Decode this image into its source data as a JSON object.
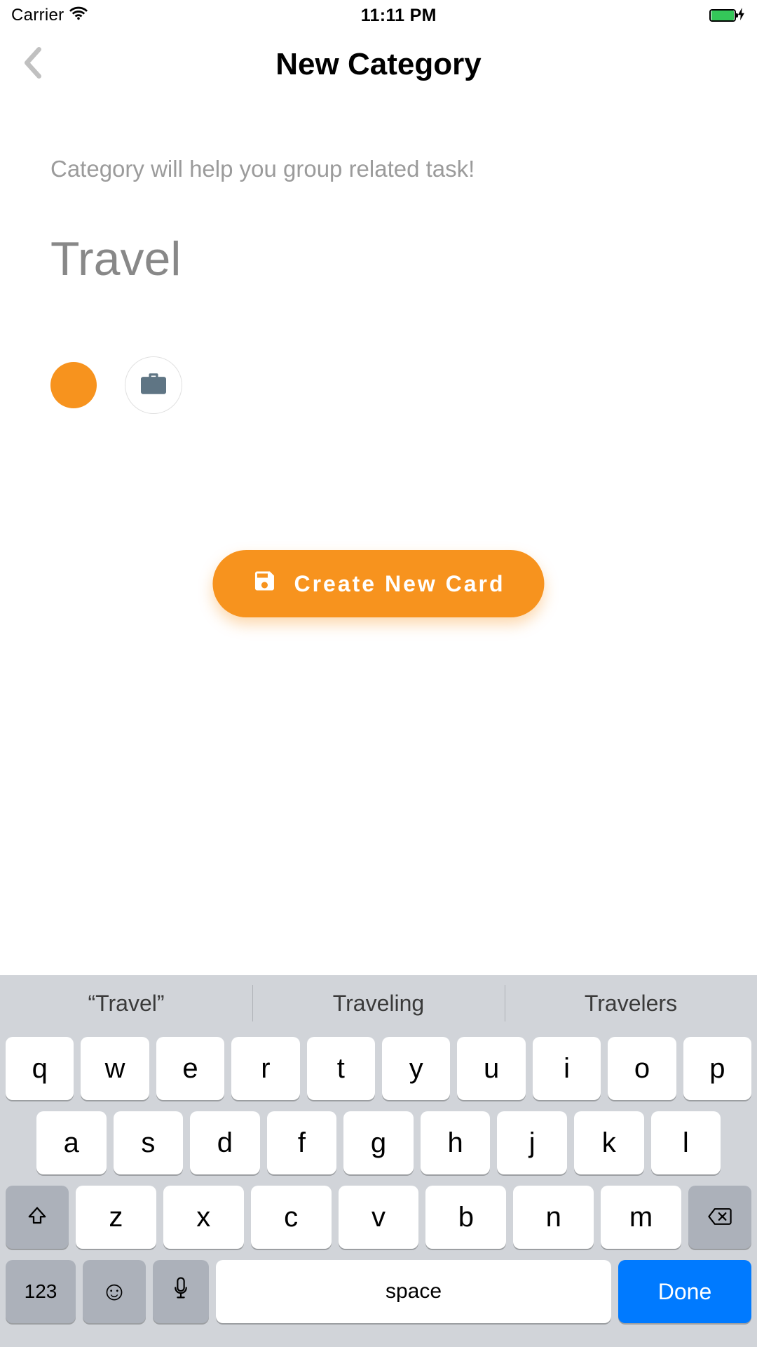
{
  "status": {
    "carrier": "Carrier",
    "time": "11:11 PM"
  },
  "nav": {
    "title": "New Category"
  },
  "helper_text": "Category will help you group related task!",
  "category_name": "Travel",
  "color_swatch": "#f7931e",
  "icon_name": "briefcase",
  "cta": {
    "label": "Create New Card"
  },
  "keyboard": {
    "suggestions": [
      "“Travel”",
      "Traveling",
      "Travelers"
    ],
    "row1": [
      "q",
      "w",
      "e",
      "r",
      "t",
      "y",
      "u",
      "i",
      "o",
      "p"
    ],
    "row2": [
      "a",
      "s",
      "d",
      "f",
      "g",
      "h",
      "j",
      "k",
      "l"
    ],
    "row3": [
      "z",
      "x",
      "c",
      "v",
      "b",
      "n",
      "m"
    ],
    "numbers_label": "123",
    "space_label": "space",
    "done_label": "Done"
  }
}
